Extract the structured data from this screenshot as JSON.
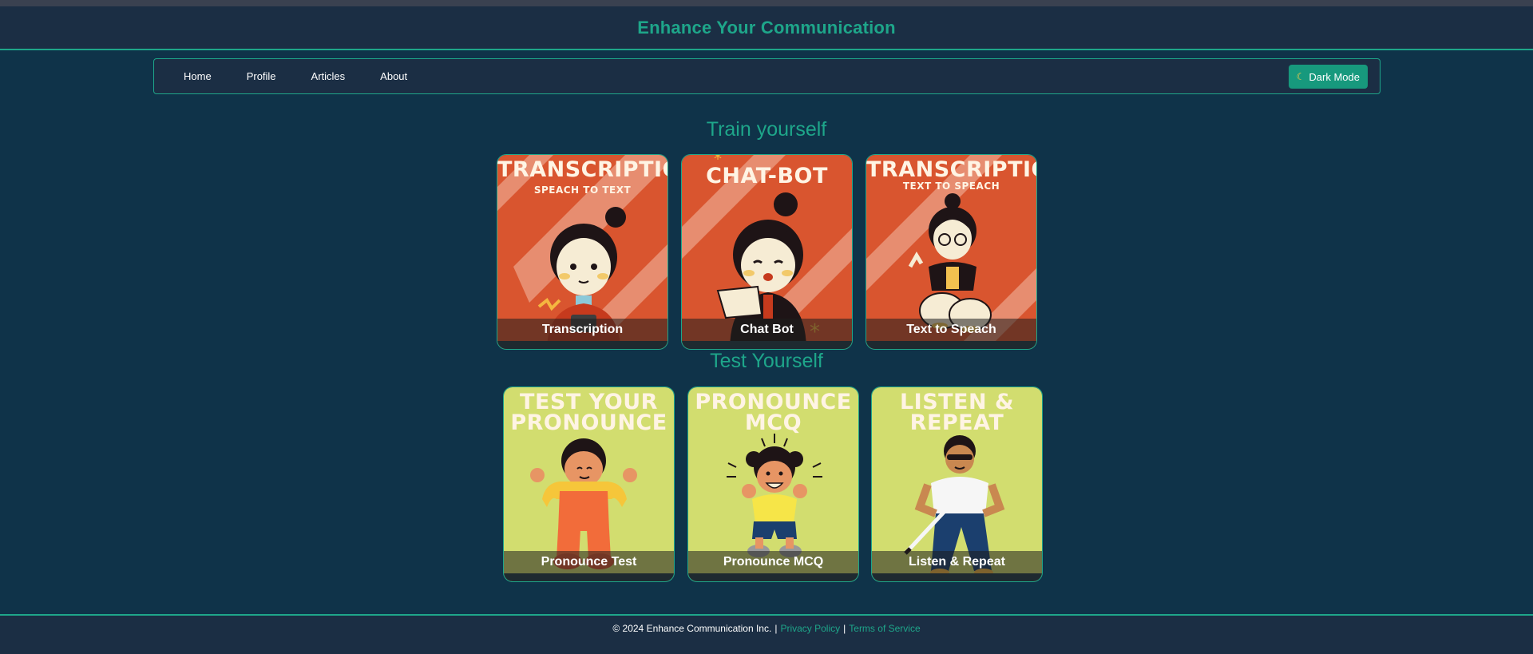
{
  "app": {
    "title": "Enhance Your Communication"
  },
  "nav": {
    "items": [
      {
        "label": "Home"
      },
      {
        "label": "Profile"
      },
      {
        "label": "Articles"
      },
      {
        "label": "About"
      }
    ],
    "dark_mode_label": "Dark Mode",
    "dark_mode_icon": "moon-icon"
  },
  "train": {
    "title": "Train yourself",
    "cards": [
      {
        "poster_title": "TRANSCRIPTION",
        "poster_sub": "SPEACH TO TEXT",
        "caption": "Transcription"
      },
      {
        "poster_title": "CHAT-BOT",
        "poster_sub": "",
        "caption": "Chat Bot"
      },
      {
        "poster_title": "TRANSCRIPTION",
        "poster_sub": "TEXT TO SPEACH",
        "caption": "Text to Speach"
      }
    ]
  },
  "test": {
    "title": "Test Yourself",
    "cards": [
      {
        "poster_title": "TEST YOUR PRONOUNCE",
        "caption": "Pronounce Test"
      },
      {
        "poster_title": "PRONOUNCE MCQ",
        "caption": "Pronounce MCQ"
      },
      {
        "poster_title": "LISTEN & REPEAT",
        "caption": "Listen & Repeat"
      }
    ]
  },
  "footer": {
    "copyright": "© 2024 Enhance Communication Inc.",
    "privacy": "Privacy Policy",
    "terms": "Terms of Service"
  },
  "colors": {
    "accent": "#1ea68a",
    "background": "#0f3349",
    "header": "#1b2e44",
    "train_card": "#d9552f",
    "test_card": "#d2dd6f"
  }
}
